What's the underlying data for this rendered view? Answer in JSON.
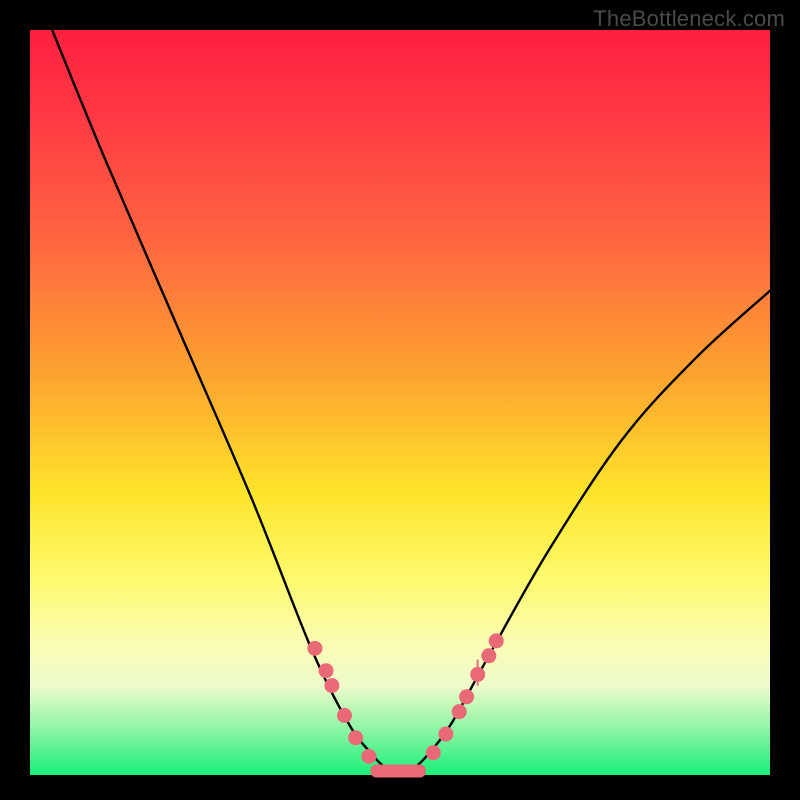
{
  "watermark": "TheBottleneck.com",
  "chart_data": {
    "type": "line",
    "title": "",
    "xlabel": "",
    "ylabel": "",
    "xlim": [
      0,
      100
    ],
    "ylim": [
      0,
      100
    ],
    "series": [
      {
        "name": "bottleneck-curve",
        "x": [
          3,
          10,
          20,
          30,
          38,
          43,
          46,
          48,
          50,
          52,
          54,
          57,
          62,
          70,
          80,
          90,
          100
        ],
        "y": [
          100,
          83,
          60,
          37,
          17,
          7,
          3,
          1,
          0,
          1,
          3,
          7,
          16,
          30,
          45,
          56,
          65
        ]
      }
    ],
    "markers": {
      "name": "highlight-dots",
      "color": "#e96a76",
      "points": [
        {
          "x": 38.5,
          "y": 17
        },
        {
          "x": 40.0,
          "y": 14
        },
        {
          "x": 40.8,
          "y": 12
        },
        {
          "x": 42.5,
          "y": 8
        },
        {
          "x": 44.0,
          "y": 5
        },
        {
          "x": 45.8,
          "y": 2.5
        },
        {
          "x": 54.5,
          "y": 3
        },
        {
          "x": 56.2,
          "y": 5.5
        },
        {
          "x": 58.0,
          "y": 8.5
        },
        {
          "x": 59.0,
          "y": 10.5
        },
        {
          "x": 60.5,
          "y": 13.5
        },
        {
          "x": 62.0,
          "y": 16
        },
        {
          "x": 63.0,
          "y": 18
        }
      ]
    },
    "flat_segment": {
      "name": "valley-bar",
      "color": "#e96a76",
      "x0": 46.0,
      "x1": 53.5,
      "y": 0.6
    },
    "gradient_stops": [
      {
        "pos": 0.0,
        "color": "#ff1f3e"
      },
      {
        "pos": 0.3,
        "color": "#fe6b3f"
      },
      {
        "pos": 0.62,
        "color": "#fee42a"
      },
      {
        "pos": 0.88,
        "color": "#eefccb"
      },
      {
        "pos": 1.0,
        "color": "#19ef7a"
      }
    ]
  }
}
